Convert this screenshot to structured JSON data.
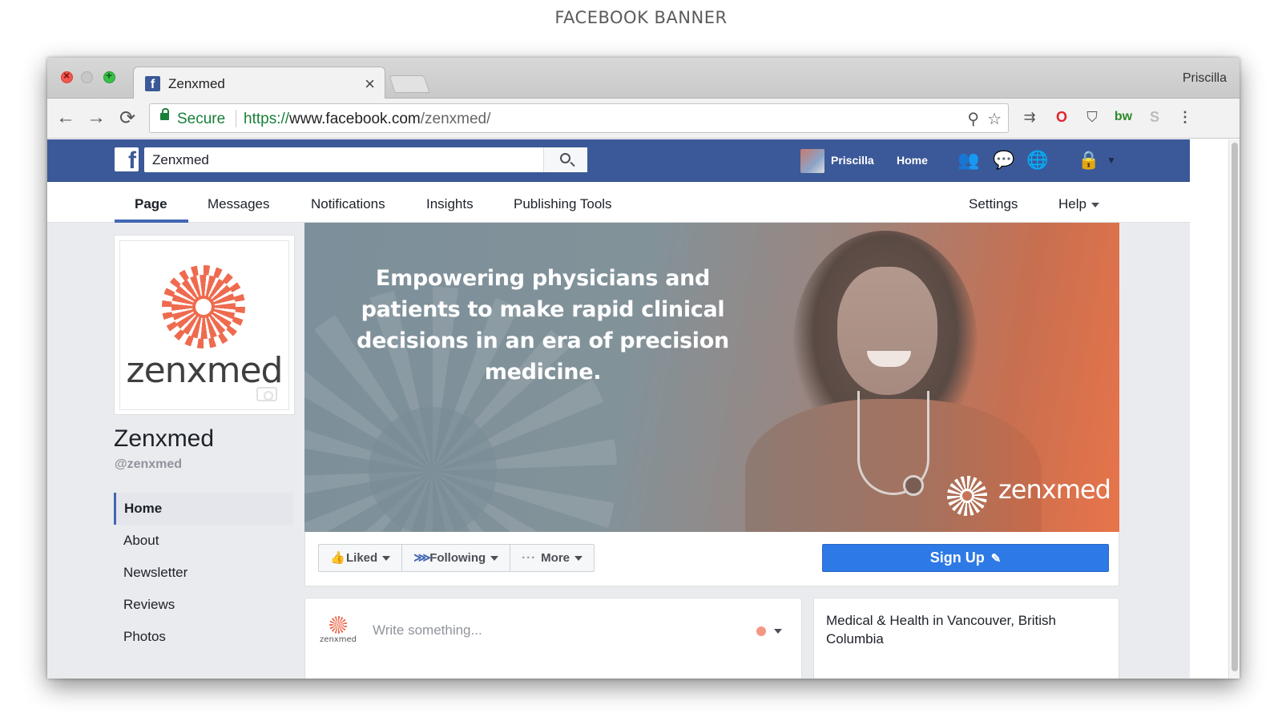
{
  "caption": "FACEBOOK BANNER",
  "browser": {
    "tab_title": "Zenxmed",
    "tab_close": "×",
    "profile_name": "Priscilla",
    "secure_label": "Secure",
    "url_scheme": "https://",
    "url_host": "www.facebook.com",
    "url_path": "/zenxmed/",
    "nav": {
      "back": "←",
      "forward": "→",
      "reload": "⟳"
    },
    "omni_icons": {
      "zoom": "⚲",
      "star": "☆"
    },
    "extensions": {
      "arrows": "⇉",
      "opera": "O",
      "pocket": "⛉",
      "bw": "bw",
      "skype": "S",
      "menu": "⋮"
    }
  },
  "fb": {
    "logo": "f",
    "search_value": "Zenxmed",
    "user_name": "Priscilla",
    "home": "Home",
    "icons": {
      "friends": "👥",
      "messages": "💬",
      "globe": "🌐",
      "lock": "🔒"
    },
    "subnav": [
      "Page",
      "Messages",
      "Notifications",
      "Insights",
      "Publishing Tools"
    ],
    "subnav_right": [
      "Settings",
      "Help"
    ],
    "page_name": "Zenxmed",
    "handle": "@zenxmed",
    "profile_word": "zenxmed",
    "sidenav": [
      "Home",
      "About",
      "Newsletter",
      "Reviews",
      "Photos"
    ],
    "cover_headline": "Empowering physicians and patients to make rapid clinical decisions in an era of precision medicine.",
    "cover_watermark": "zenxmed",
    "actions": {
      "liked": "Liked",
      "following": "Following",
      "more": "More",
      "signup": "Sign Up"
    },
    "action_icons": {
      "like": "👍",
      "rss": "⋙",
      "dots": "···",
      "pencil": "✎"
    },
    "composer_placeholder": "Write something...",
    "composer_avatar_word": "zenxmed",
    "category": "Medical & Health in Vancouver, British Columbia"
  },
  "colors": {
    "fb_blue": "#3b5998",
    "signup_blue": "#2d7ae6",
    "brand_coral": "#ef6b4f",
    "secure_green": "#188038"
  }
}
